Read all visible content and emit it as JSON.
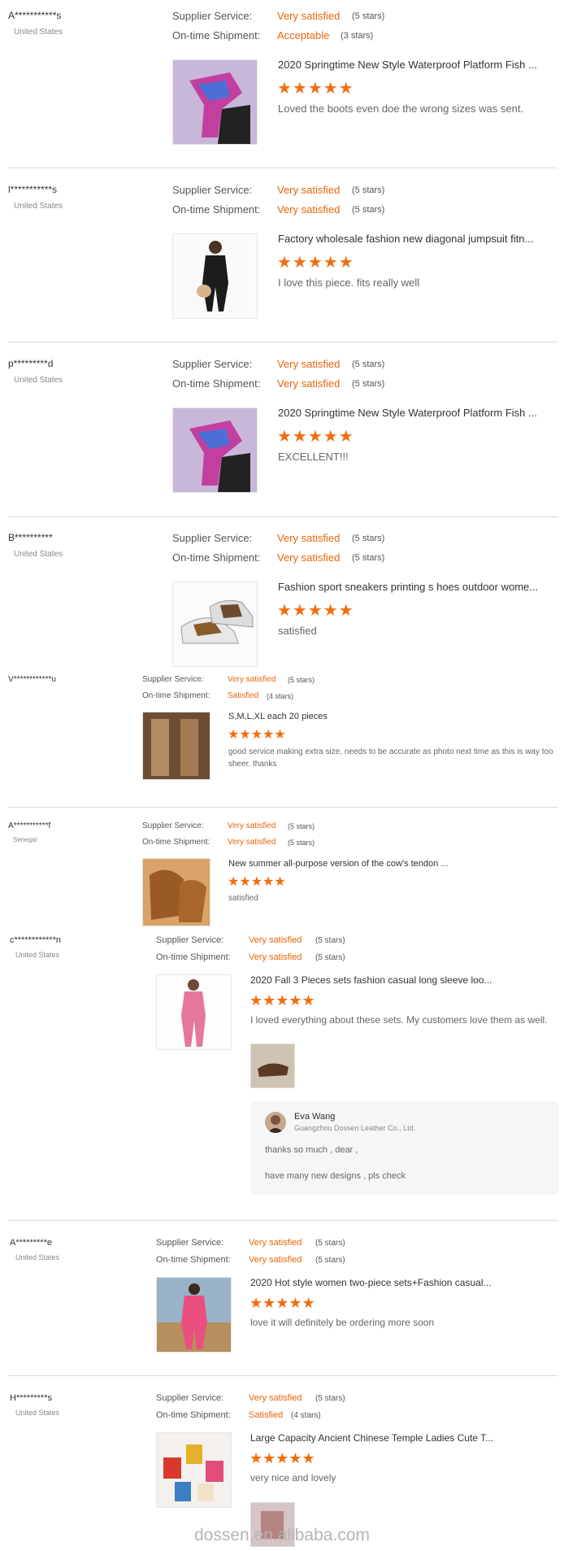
{
  "reviews": [
    {
      "name": "A***********s",
      "country": "United States",
      "supplier_label": "Supplier Service:",
      "supplier_value": "Very satisfied",
      "supplier_stars": "(5 stars)",
      "shipment_label": "On-time Shipment:",
      "shipment_value": "Acceptable",
      "shipment_stars": "(3 stars)",
      "product": "2020 Springtime New Style Waterproof Platform Fish ...",
      "rating": "★★★★★",
      "comment": "Loved the boots even doe the wrong sizes was sent."
    },
    {
      "name": "l***********s",
      "country": "United States",
      "supplier_label": "Supplier Service:",
      "supplier_value": "Very satisfied",
      "supplier_stars": "(5 stars)",
      "shipment_label": "On-time Shipment:",
      "shipment_value": "Very satisfied",
      "shipment_stars": "(5 stars)",
      "product": "Factory wholesale fashion new diagonal jumpsuit fitn...",
      "rating": "★★★★★",
      "comment": "I love this piece. fits really well"
    },
    {
      "name": "p*********d",
      "country": "United States",
      "supplier_label": "Supplier Service:",
      "supplier_value": "Very satisfied",
      "supplier_stars": "(5 stars)",
      "shipment_label": "On-time Shipment:",
      "shipment_value": "Very satisfied",
      "shipment_stars": "(5 stars)",
      "product": "2020 Springtime New Style Waterproof Platform Fish ...",
      "rating": "★★★★★",
      "comment": "EXCELLENT!!!"
    },
    {
      "name": "B**********",
      "country": "United States",
      "supplier_label": "Supplier Service:",
      "supplier_value": "Very satisfied",
      "supplier_stars": "(5 stars)",
      "shipment_label": "On-time Shipment:",
      "shipment_value": "Very satisfied",
      "shipment_stars": "(5 stars)",
      "product": "Fashion sport sneakers printing s hoes outdoor wome...",
      "rating": "★★★★★",
      "comment": "satisfied"
    },
    {
      "name": "V************u",
      "country": "",
      "supplier_label": "Supplier Service:",
      "supplier_value": "Very satisfied",
      "supplier_stars": "(5 stars)",
      "shipment_label": "On-time Shipment:",
      "shipment_value": "Satisfied",
      "shipment_stars": "(4 stars)",
      "product": "S,M,L,XL each 20 pieces",
      "rating": "★★★★★",
      "comment": "good service making extra size, needs to be accurate as photo next time as this is way too sheer. thanks"
    },
    {
      "name": "A***********f",
      "country": "Senegal",
      "supplier_label": "Supplier Service:",
      "supplier_value": "Very satisfied",
      "supplier_stars": "(5 stars)",
      "shipment_label": "On-time Shipment:",
      "shipment_value": "Very satisfied",
      "shipment_stars": "(5 stars)",
      "product": "New summer all-purpose version of the cow's tendon ...",
      "rating": "★★★★★",
      "comment": "satisfied"
    },
    {
      "name": "c************n",
      "country": "United States",
      "supplier_label": "Supplier Service:",
      "supplier_value": "Very satisfied",
      "supplier_stars": "(5 stars)",
      "shipment_label": "On-time Shipment:",
      "shipment_value": "Very satisfied",
      "shipment_stars": "(5 stars)",
      "product": "2020 Fall 3 Pieces sets fashion casual long sleeve loo...",
      "rating": "★★★★★",
      "comment": "I loved everything about these sets. My customers love them as well.",
      "reply": {
        "name": "Eva Wang",
        "company": "Guangzhou Dossen Leather Co., Ltd.",
        "line1": "thanks so much , dear ,",
        "line2": "have many new designs  , pls check"
      }
    },
    {
      "name": "A*********e",
      "country": "United States",
      "supplier_label": "Supplier Service:",
      "supplier_value": "Very satisfied",
      "supplier_stars": "(5 stars)",
      "shipment_label": "On-time Shipment:",
      "shipment_value": "Very satisfied",
      "shipment_stars": "(5 stars)",
      "product": "2020 Hot style women two-piece sets+Fashion casual...",
      "rating": "★★★★★",
      "comment": "love it will definitely be ordering more soon"
    },
    {
      "name": "H*********s",
      "country": "United States",
      "supplier_label": "Supplier Service:",
      "supplier_value": "Very satisfied",
      "supplier_stars": "(5 stars)",
      "shipment_label": "On-time Shipment:",
      "shipment_value": "Satisfied",
      "shipment_stars": "(4 stars)",
      "product": "Large Capacity Ancient Chinese Temple Ladies Cute T...",
      "rating": "★★★★★",
      "comment": "very nice and lovely"
    }
  ],
  "watermark": "dossen.en.alibaba.com",
  "colors": {
    "accent": "#e8650a",
    "star": "#f26d0f"
  }
}
